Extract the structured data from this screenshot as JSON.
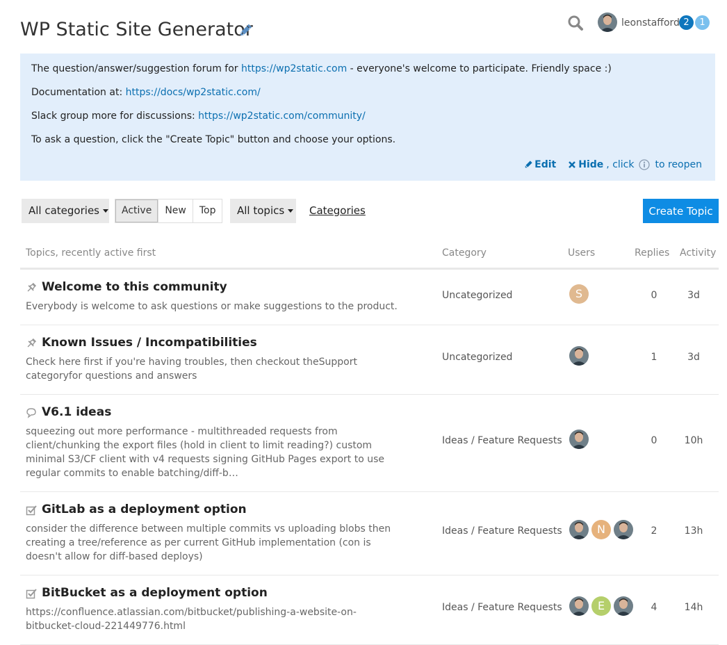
{
  "header": {
    "title": "WP Static Site Generator",
    "username": "leonstafford",
    "notifications": [
      "2",
      "1"
    ]
  },
  "banner": {
    "line1_pre": "The question/answer/suggestion forum for ",
    "line1_link": "https://wp2static.com",
    "line1_post": " - everyone's welcome to participate. Friendly space :)",
    "line2_pre": "Documentation at: ",
    "line2_link": "https://docs/wp2static.com/",
    "line3_pre": "Slack group more for discussions: ",
    "line3_link": "https://wp2static.com/community/",
    "line4": "To ask a question, click the \"Create Topic\" button and choose your options.",
    "edit_label": "Edit",
    "hide_label": "Hide",
    "hide_suffix_1": ", click",
    "hide_suffix_2": "to reopen"
  },
  "nav": {
    "categories_dropdown": "All categories",
    "filters": [
      "Active",
      "New",
      "Top"
    ],
    "topics_dropdown": "All topics",
    "categories_link": "Categories",
    "create_topic": "Create Topic"
  },
  "table": {
    "headers": {
      "topics": "Topics, recently active first",
      "category": "Category",
      "users": "Users",
      "replies": "Replies",
      "activity": "Activity"
    },
    "rows": [
      {
        "icon": "pin-icon",
        "title": "Welcome to this community",
        "excerpt": "Everybody is welcome to ask questions or make suggestions to the product.",
        "category": "Uncategorized",
        "users": [
          {
            "type": "letter",
            "letter": "S",
            "color": "#e0b990"
          }
        ],
        "replies": "0",
        "activity": "3d"
      },
      {
        "icon": "pin-icon",
        "title": "Known Issues / Incompatibilities",
        "excerpt": "Check here first if you're having troubles, then checkout theSupport categoryfor questions and answers",
        "category": "Uncategorized",
        "users": [
          {
            "type": "photo"
          }
        ],
        "replies": "1",
        "activity": "3d"
      },
      {
        "icon": "chat-bubble-icon",
        "title": "V6.1 ideas",
        "excerpt": "squeezing out more performance - multithreaded requests from client/chunking the export files (hold in client to limit reading?) custom minimal S3/CF client with v4 requests signing GitHub Pages export to use regular commits to enable batching/diff-b…",
        "category": "Ideas / Feature Requests",
        "users": [
          {
            "type": "photo"
          }
        ],
        "replies": "0",
        "activity": "10h"
      },
      {
        "icon": "checkbox-icon",
        "title": "GitLab as a deployment option",
        "excerpt": "consider the difference between multiple commits vs uploading blobs then creating a tree/reference as per current GitHub implementation (con is doesn't allow for diff-based deploys)",
        "category": "Ideas / Feature Requests",
        "users": [
          {
            "type": "photo"
          },
          {
            "type": "letter",
            "letter": "N",
            "color": "#e6b27c"
          },
          {
            "type": "photo"
          }
        ],
        "replies": "2",
        "activity": "13h"
      },
      {
        "icon": "checkbox-icon",
        "title": "BitBucket as a deployment option",
        "excerpt": "https://confluence.atlassian.com/bitbucket/publishing-a-website-on-bitbucket-cloud-221449776.html",
        "category": "Ideas / Feature Requests",
        "users": [
          {
            "type": "photo"
          },
          {
            "type": "letter",
            "letter": "E",
            "color": "#b5cf6b"
          },
          {
            "type": "photo"
          }
        ],
        "replies": "4",
        "activity": "14h"
      }
    ]
  },
  "colors": {
    "accent": "#0e8ce4",
    "link": "#0b6fb0",
    "banner_bg": "#e2eefb",
    "badge_primary": "#0e76bd",
    "badge_secondary": "#7ac0ee"
  }
}
